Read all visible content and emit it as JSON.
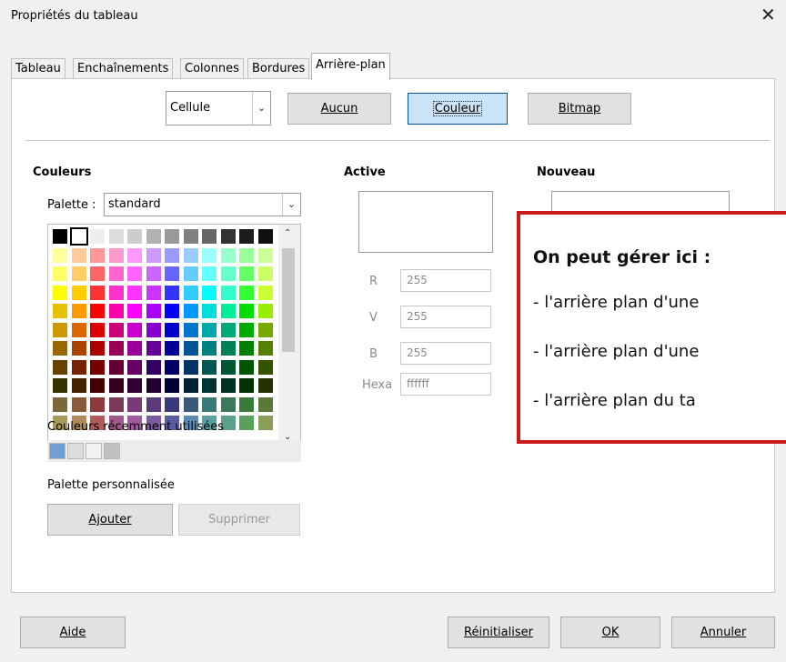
{
  "window": {
    "title": "Propriétés du tableau",
    "close_glyph": "✕"
  },
  "tabs": [
    "Tableau",
    "Enchaînements",
    "Colonnes",
    "Bordures",
    "Arrière-plan"
  ],
  "toolbar": {
    "target_select": "Cellule",
    "buttons": [
      "Aucun",
      "Couleur",
      "Bitmap"
    ],
    "selected_button": "Couleur"
  },
  "colors": {
    "section_label": "Couleurs",
    "palette_label": "Palette :",
    "palette_value": "standard",
    "recent_label": "Couleurs récemment utilisées",
    "custom_label": "Palette personnalisée",
    "add_button": "Ajouter",
    "delete_button": "Supprimer",
    "recent_swatches": [
      "#729fcf",
      "#dddddd",
      "#f2f2f2",
      "#c0c0c0"
    ],
    "palette_rows": [
      [
        "#000000",
        "#ffffff",
        "#eeeeee",
        "#dddddd",
        "#cccccc",
        "#b2b2b2",
        "#999999",
        "#808080",
        "#666666",
        "#333333",
        "#1c1c1c",
        "#111111"
      ],
      [
        "#ffff99",
        "#ffcc99",
        "#ff9999",
        "#ff99cc",
        "#ff99ff",
        "#cc99ff",
        "#9999ff",
        "#99ccff",
        "#99ffff",
        "#99ffcc",
        "#99ff99",
        "#ccff99"
      ],
      [
        "#ffff66",
        "#ffcc66",
        "#ff6666",
        "#ff66cc",
        "#ff66ff",
        "#cc66ff",
        "#6666ff",
        "#66ccff",
        "#66ffff",
        "#66ffcc",
        "#66ff66",
        "#ccff66"
      ],
      [
        "#ffff00",
        "#ffcc00",
        "#ff3333",
        "#ff33cc",
        "#ff33ff",
        "#cc33ff",
        "#3333ff",
        "#33ccff",
        "#00ffff",
        "#33ffcc",
        "#33ff33",
        "#ccff33"
      ],
      [
        "#e6c200",
        "#ff9900",
        "#ff0000",
        "#ff00aa",
        "#ff00ff",
        "#aa00ff",
        "#0000ff",
        "#0099ff",
        "#00dddd",
        "#00ee99",
        "#00dd00",
        "#99ee00"
      ],
      [
        "#cc9900",
        "#dd6600",
        "#dd0000",
        "#cc0077",
        "#cc00cc",
        "#8800cc",
        "#0000cc",
        "#0077cc",
        "#00aaaa",
        "#00aa77",
        "#00aa00",
        "#77aa00"
      ],
      [
        "#996600",
        "#aa4400",
        "#aa0000",
        "#990055",
        "#990099",
        "#660099",
        "#000099",
        "#005599",
        "#008080",
        "#008055",
        "#008000",
        "#558000"
      ],
      [
        "#664400",
        "#772200",
        "#770000",
        "#660033",
        "#660066",
        "#330066",
        "#000066",
        "#003366",
        "#005555",
        "#005533",
        "#005500",
        "#335500"
      ],
      [
        "#333300",
        "#442200",
        "#440000",
        "#330022",
        "#330033",
        "#220033",
        "#000033",
        "#002233",
        "#003333",
        "#003322",
        "#003300",
        "#223300"
      ],
      [
        "#7a6a3a",
        "#8a5a3a",
        "#8a3a3a",
        "#7a3a5a",
        "#7a3a7a",
        "#5a3a7a",
        "#3a3a7a",
        "#3a5a7a",
        "#3a7a7a",
        "#3a7a5a",
        "#3a7a3a",
        "#5a7a3a"
      ],
      [
        "#a89a5a",
        "#b08a5a",
        "#b05a5a",
        "#a05a8a",
        "#a05aa0",
        "#7a5aa0",
        "#5a5aa0",
        "#5a8ab0",
        "#5aa0a0",
        "#5aa08a",
        "#5aa05a",
        "#8aa05a"
      ]
    ]
  },
  "active": {
    "label": "Active",
    "fields": [
      {
        "label": "R",
        "value": "255"
      },
      {
        "label": "V",
        "value": "255"
      },
      {
        "label": "B",
        "value": "255"
      },
      {
        "label": "Hexa",
        "value": "ffffff"
      }
    ]
  },
  "nouveau": {
    "label": "Nouveau"
  },
  "overlay": {
    "heading": "On peut gérer ici :",
    "lines": [
      "- l'arrière plan d'une",
      "- l'arrière plan d'une",
      "- l'arrière plan du ta"
    ],
    "border_color": "#cc1a1a"
  },
  "footer": {
    "help": "Aide",
    "reset": "Réinitialiser",
    "ok": "OK",
    "cancel": "Annuler"
  }
}
